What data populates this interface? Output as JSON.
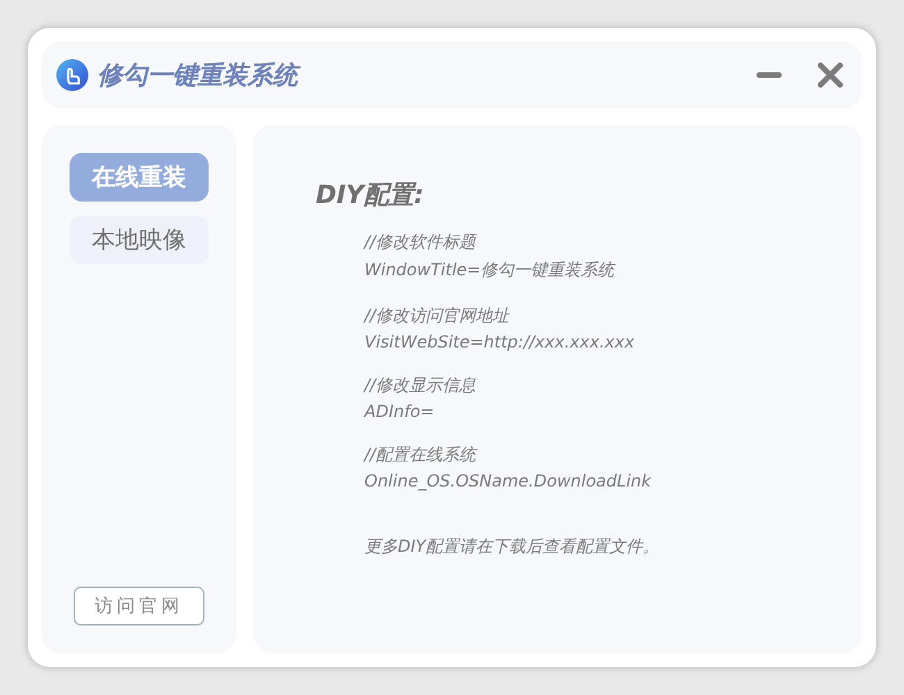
{
  "window": {
    "title": "修勾一键重装系统"
  },
  "nav": [
    {
      "label": "在线重装",
      "selected": true
    },
    {
      "label": "本地映像",
      "selected": false
    }
  ],
  "visit_button": "访问官网",
  "content": {
    "heading": "DIY配置:",
    "entries": [
      {
        "comment": "//修改软件标题",
        "value": "WindowTitle=修勾一键重装系统"
      },
      {
        "comment": "//修改访问官网地址",
        "value": "VisitWebSite=http://xxx.xxx.xxx"
      },
      {
        "comment": "//修改显示信息",
        "value": "ADInfo="
      },
      {
        "comment": "//配置在线系统",
        "value": "Online_OS.OSName.DownloadLink"
      }
    ],
    "note": "更多DIY配置请在下载后查看配置文件。"
  }
}
